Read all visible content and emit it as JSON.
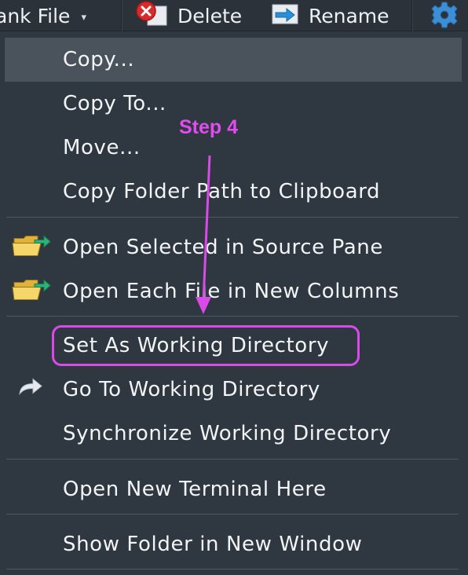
{
  "toolbar": {
    "blank_file_label": "ank File",
    "caret": "▾",
    "delete_label": "Delete",
    "rename_label": "Rename"
  },
  "menu": {
    "items": [
      {
        "label": "Copy..."
      },
      {
        "label": "Copy To..."
      },
      {
        "label": "Move..."
      },
      {
        "label": "Copy Folder Path to Clipboard"
      },
      {
        "label": "Open Selected in Source Pane"
      },
      {
        "label": "Open Each File in New Columns"
      },
      {
        "label": "Set As Working Directory"
      },
      {
        "label": "Go To Working Directory"
      },
      {
        "label": "Synchronize Working Directory"
      },
      {
        "label": "Open New Terminal Here"
      },
      {
        "label": "Show Folder in New Window"
      }
    ]
  },
  "annotation": {
    "step_label": "Step 4",
    "color": "#d84be8"
  },
  "colors": {
    "background": "#2f3740",
    "highlight": "#4a525b",
    "text": "#f2f4f6"
  }
}
